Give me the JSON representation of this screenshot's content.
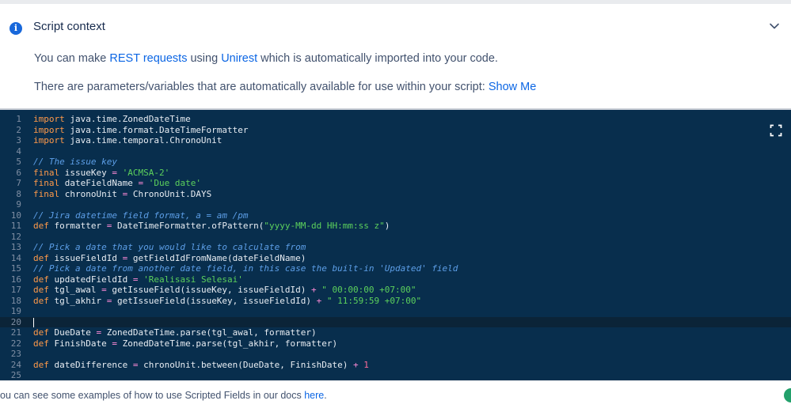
{
  "context": {
    "info_icon": "info-icon",
    "title": "Script context",
    "chevron_icon": "chevron-down-icon",
    "line1": {
      "before": "You can make ",
      "link1": "REST requests",
      "mid": " using ",
      "link2": "Unirest",
      "after": " which is automatically imported into your code."
    },
    "line2": {
      "before": "There are parameters/variables that are automatically available for use within your script: ",
      "link": "Show Me"
    }
  },
  "editor": {
    "fullscreen_icon": "fullscreen-icon",
    "active_line": 20,
    "lines": [
      {
        "n": "1",
        "tokens": [
          {
            "t": "kw",
            "v": "import"
          },
          {
            "t": "tx",
            "v": " java.time.ZonedDateTime"
          }
        ]
      },
      {
        "n": "2",
        "tokens": [
          {
            "t": "kw",
            "v": "import"
          },
          {
            "t": "tx",
            "v": " java.time.format.DateTimeFormatter"
          }
        ]
      },
      {
        "n": "3",
        "tokens": [
          {
            "t": "kw",
            "v": "import"
          },
          {
            "t": "tx",
            "v": " java.time.temporal.ChronoUnit"
          }
        ]
      },
      {
        "n": "4",
        "tokens": []
      },
      {
        "n": "5",
        "tokens": [
          {
            "t": "cm",
            "v": "// The issue key"
          }
        ]
      },
      {
        "n": "6",
        "tokens": [
          {
            "t": "kw",
            "v": "final"
          },
          {
            "t": "tx",
            "v": " issueKey "
          },
          {
            "t": "op",
            "v": "="
          },
          {
            "t": "tx",
            "v": " "
          },
          {
            "t": "st",
            "v": "'ACMSA-2'"
          }
        ]
      },
      {
        "n": "7",
        "tokens": [
          {
            "t": "kw",
            "v": "final"
          },
          {
            "t": "tx",
            "v": " dateFieldName "
          },
          {
            "t": "op",
            "v": "="
          },
          {
            "t": "tx",
            "v": " "
          },
          {
            "t": "st",
            "v": "'Due date'"
          }
        ]
      },
      {
        "n": "8",
        "tokens": [
          {
            "t": "kw",
            "v": "final"
          },
          {
            "t": "tx",
            "v": " chronoUnit "
          },
          {
            "t": "op",
            "v": "="
          },
          {
            "t": "tx",
            "v": " ChronoUnit.DAYS"
          }
        ]
      },
      {
        "n": "9",
        "tokens": []
      },
      {
        "n": "10",
        "tokens": [
          {
            "t": "cm",
            "v": "// Jira datetime field format, a = am /pm"
          }
        ]
      },
      {
        "n": "11",
        "tokens": [
          {
            "t": "kw",
            "v": "def"
          },
          {
            "t": "tx",
            "v": " formatter "
          },
          {
            "t": "op",
            "v": "="
          },
          {
            "t": "tx",
            "v": " DateTimeFormatter.ofPattern("
          },
          {
            "t": "st",
            "v": "\"yyyy-MM-dd HH:mm:ss z\""
          },
          {
            "t": "tx",
            "v": ")"
          }
        ]
      },
      {
        "n": "12",
        "tokens": []
      },
      {
        "n": "13",
        "tokens": [
          {
            "t": "cm",
            "v": "// Pick a date that you would like to calculate from"
          }
        ]
      },
      {
        "n": "14",
        "tokens": [
          {
            "t": "kw",
            "v": "def"
          },
          {
            "t": "tx",
            "v": " issueFieldId "
          },
          {
            "t": "op",
            "v": "="
          },
          {
            "t": "tx",
            "v": " getFieldIdFromName(dateFieldName)"
          }
        ]
      },
      {
        "n": "15",
        "tokens": [
          {
            "t": "cm",
            "v": "// Pick a date from another date field, in this case the built-in 'Updated' field"
          }
        ]
      },
      {
        "n": "16",
        "tokens": [
          {
            "t": "kw",
            "v": "def"
          },
          {
            "t": "tx",
            "v": " updatedFieldId "
          },
          {
            "t": "op",
            "v": "="
          },
          {
            "t": "tx",
            "v": " "
          },
          {
            "t": "st",
            "v": "'Realisasi Selesai'"
          }
        ]
      },
      {
        "n": "17",
        "tokens": [
          {
            "t": "kw",
            "v": "def"
          },
          {
            "t": "tx",
            "v": " tgl_awal "
          },
          {
            "t": "op",
            "v": "="
          },
          {
            "t": "tx",
            "v": " getIssueField(issueKey, issueFieldId) "
          },
          {
            "t": "op",
            "v": "+"
          },
          {
            "t": "tx",
            "v": " "
          },
          {
            "t": "st",
            "v": "\" 00:00:00 +07:00\""
          }
        ]
      },
      {
        "n": "18",
        "tokens": [
          {
            "t": "kw",
            "v": "def"
          },
          {
            "t": "tx",
            "v": " tgl_akhir "
          },
          {
            "t": "op",
            "v": "="
          },
          {
            "t": "tx",
            "v": " getIssueField(issueKey, issueFieldId) "
          },
          {
            "t": "op",
            "v": "+"
          },
          {
            "t": "tx",
            "v": " "
          },
          {
            "t": "st",
            "v": "\" 11:59:59 +07:00\""
          }
        ]
      },
      {
        "n": "19",
        "tokens": []
      },
      {
        "n": "20",
        "tokens": []
      },
      {
        "n": "21",
        "tokens": [
          {
            "t": "kw",
            "v": "def"
          },
          {
            "t": "tx",
            "v": " DueDate "
          },
          {
            "t": "op",
            "v": "="
          },
          {
            "t": "tx",
            "v": " ZonedDateTime.parse(tgl_awal, formatter)"
          }
        ]
      },
      {
        "n": "22",
        "tokens": [
          {
            "t": "kw",
            "v": "def"
          },
          {
            "t": "tx",
            "v": " FinishDate "
          },
          {
            "t": "op",
            "v": "="
          },
          {
            "t": "tx",
            "v": " ZonedDateTime.parse(tgl_akhir, formatter)"
          }
        ]
      },
      {
        "n": "23",
        "tokens": []
      },
      {
        "n": "24",
        "tokens": [
          {
            "t": "kw",
            "v": "def"
          },
          {
            "t": "tx",
            "v": " dateDifference "
          },
          {
            "t": "op",
            "v": "="
          },
          {
            "t": "tx",
            "v": " chronoUnit.between(DueDate, FinishDate) "
          },
          {
            "t": "op",
            "v": "+"
          },
          {
            "t": "tx",
            "v": " "
          },
          {
            "t": "nm",
            "v": "1"
          }
        ]
      },
      {
        "n": "25",
        "tokens": []
      }
    ]
  },
  "footer": {
    "text": "ou can see some examples of how to use Scripted Fields in our docs ",
    "link": "here",
    "end": "."
  }
}
